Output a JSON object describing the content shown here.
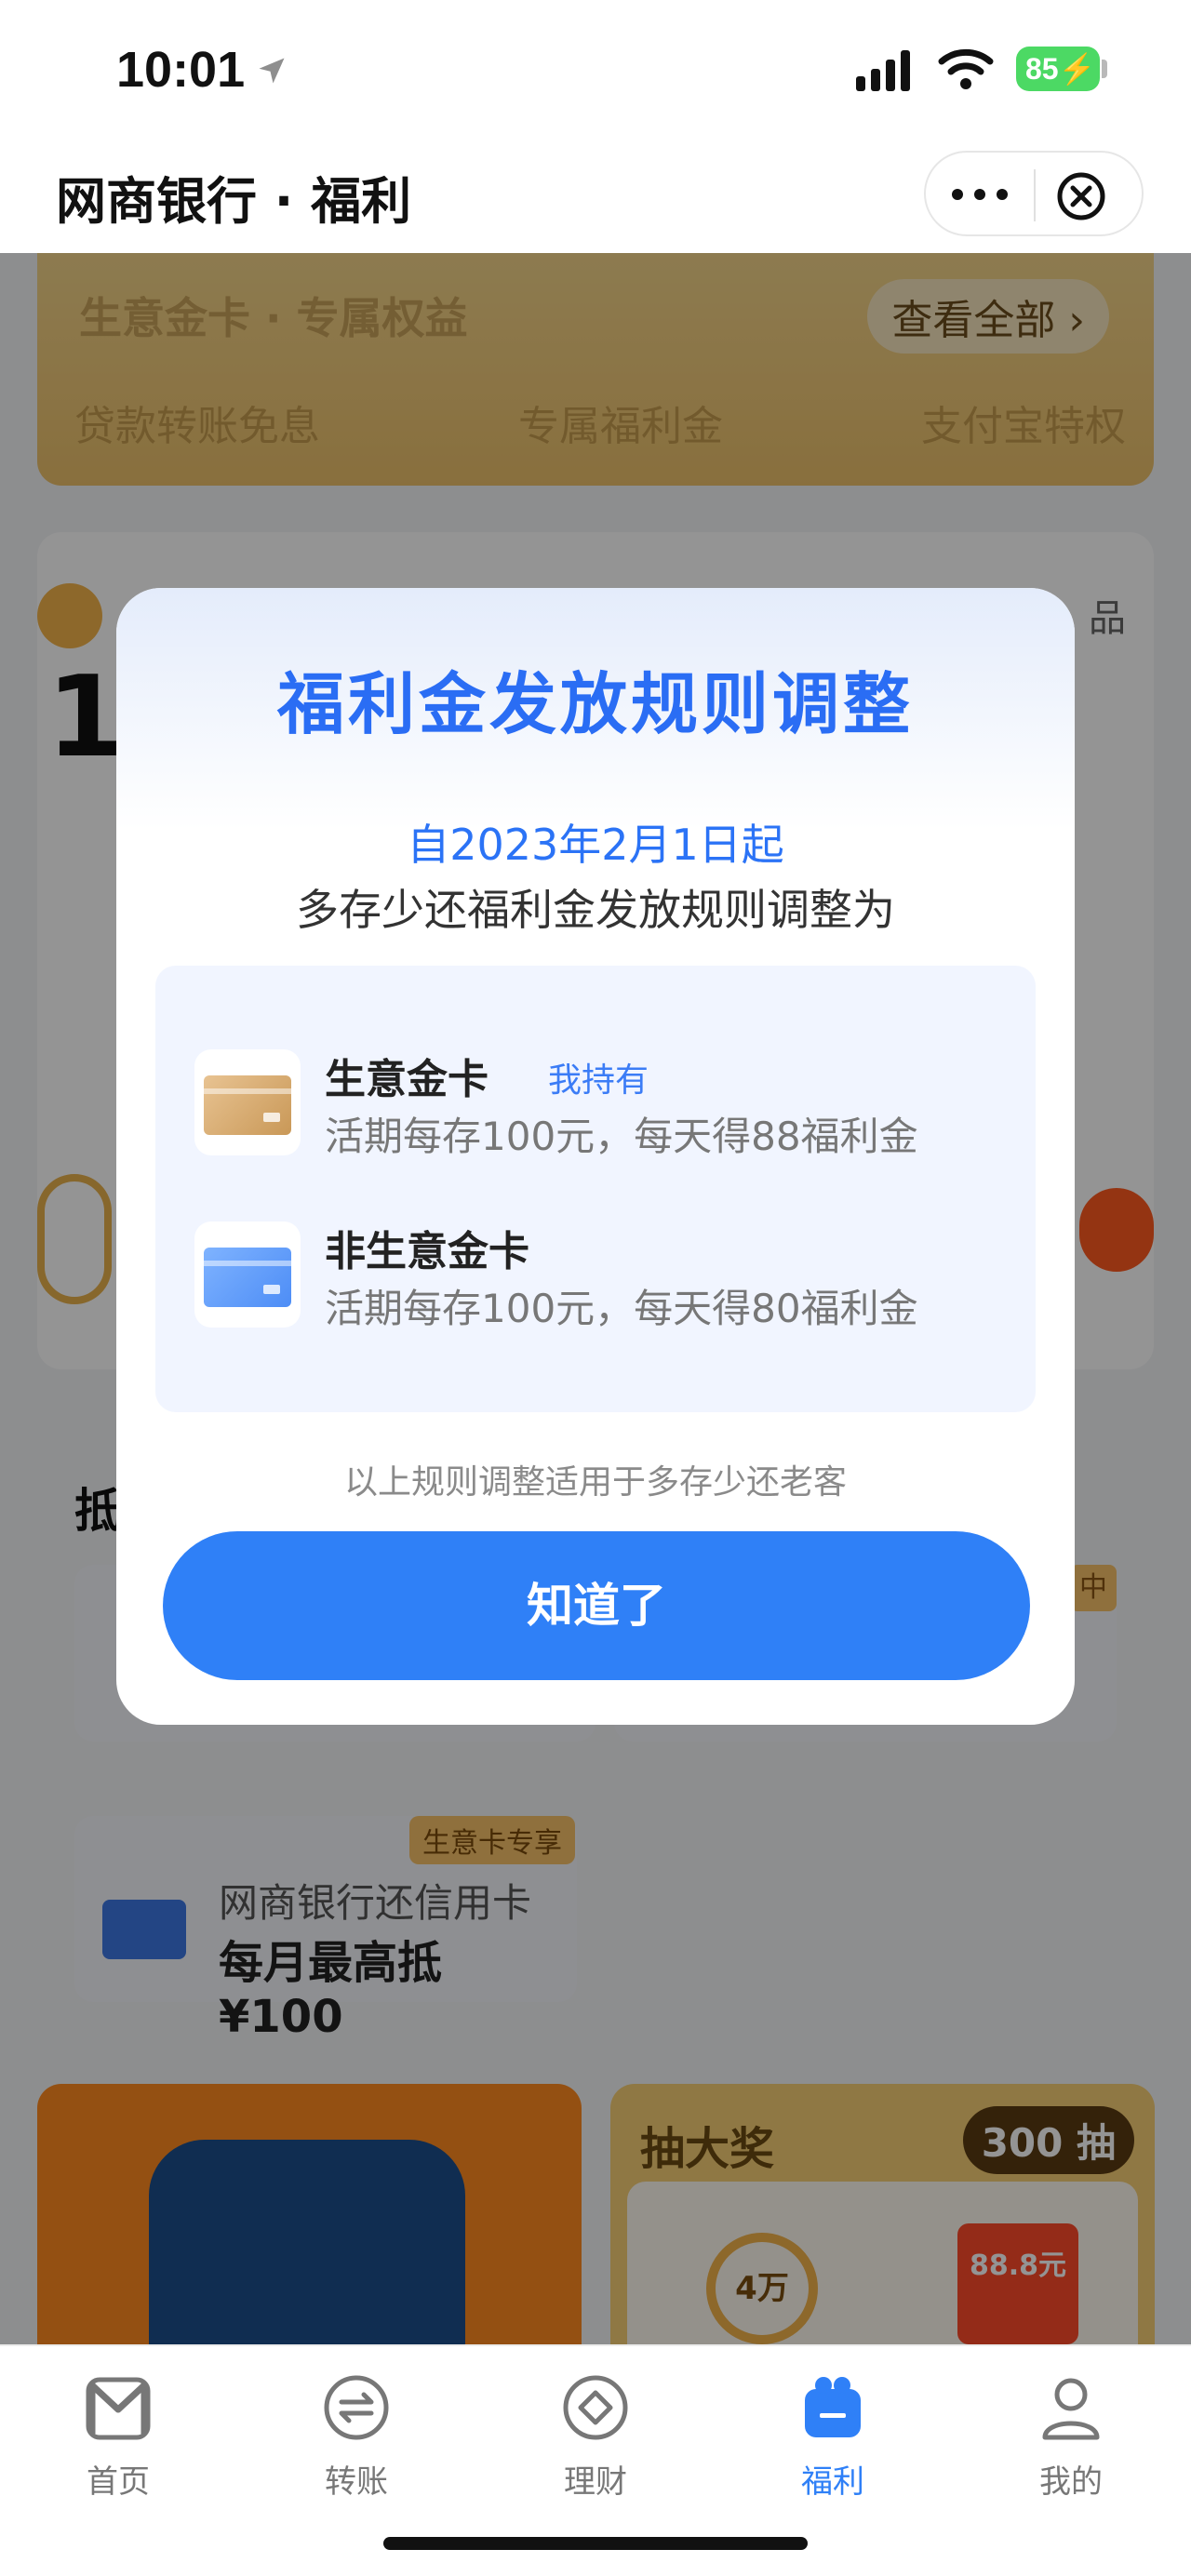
{
  "status_bar": {
    "time": "10:01",
    "battery": "85",
    "battery_color": "#4cd964"
  },
  "title_bar": {
    "title": "网商银行 · 福利",
    "more_icon": "more-dots-icon",
    "close_icon": "close-circle-icon"
  },
  "background": {
    "gold_card": {
      "title": "生意金卡 · 专属权益",
      "view_all": "查看全部 ›",
      "perks": [
        "贷款转账免息",
        "专属福利金",
        "支付宝特权"
      ]
    },
    "first_digit": "1",
    "pin_text": "品",
    "section_head": "抵",
    "mid_tag": "中",
    "promo": {
      "badge": "生意卡专享",
      "line1": "网商银行还信用卡",
      "line2": "每月最高抵 ¥100"
    },
    "lottery": {
      "title": "抽大奖",
      "count": "300 抽",
      "coin": "4万",
      "red_packet": "88.8元"
    }
  },
  "modal": {
    "title": "福利金发放规则调整",
    "date_line": "自2023年2月1日起",
    "subtitle": "多存少还福利金发放规则调整为",
    "rules": [
      {
        "name": "生意金卡",
        "tag": "我持有",
        "desc": "活期每存100元，每天得88福利金",
        "card_color": "#d6ad72"
      },
      {
        "name": "非生意金卡",
        "tag": "",
        "desc": "活期每存100元，每天得80福利金",
        "card_color": "#5e99f8"
      }
    ],
    "note": "以上规则调整适用于多存少还老客",
    "button": "知道了",
    "accent": "#2f80f7"
  },
  "tab_bar": {
    "tabs": [
      {
        "label": "首页",
        "icon": "home-m-icon",
        "active": false
      },
      {
        "label": "转账",
        "icon": "transfer-icon",
        "active": false
      },
      {
        "label": "理财",
        "icon": "finance-icon",
        "active": false
      },
      {
        "label": "福利",
        "icon": "gift-icon",
        "active": true
      },
      {
        "label": "我的",
        "icon": "profile-icon",
        "active": false
      }
    ]
  }
}
